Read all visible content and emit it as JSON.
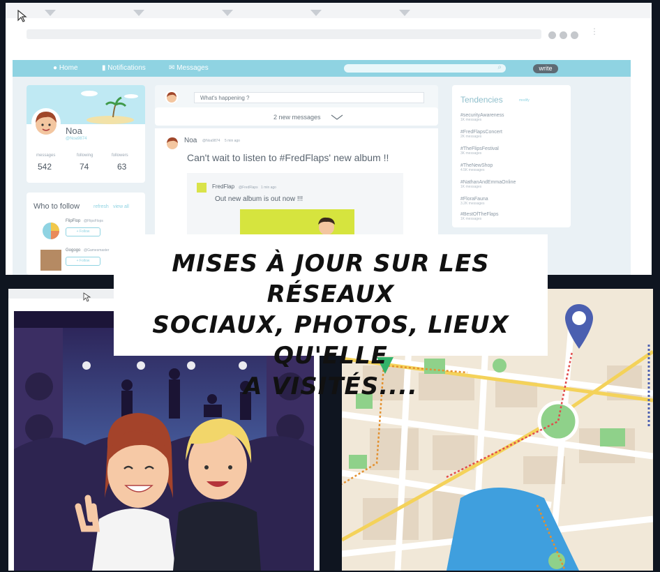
{
  "nav": {
    "home": "Home",
    "notifications": "Notifications",
    "messages": "Messages",
    "write": "write"
  },
  "composer": {
    "placeholder": "What's happening ?",
    "new_messages": "2 new messages"
  },
  "profile": {
    "name": "Noa",
    "handle": "@Noa9874",
    "stats": [
      {
        "label": "messages",
        "value": "542"
      },
      {
        "label": "following",
        "value": "74"
      },
      {
        "label": "followers",
        "value": "63"
      }
    ]
  },
  "who_to_follow": {
    "title": "Who to follow",
    "refresh": "refresh",
    "view_all": "view all",
    "suggestions": [
      {
        "name": "FlipFlop",
        "handle": "@FlipsFlops",
        "button": "+ Follow"
      },
      {
        "name": "Gogogo",
        "handle": "@Gamesmaster",
        "button": "+ Follow"
      }
    ]
  },
  "post": {
    "author": "Noa",
    "handle": "@Noa9874",
    "time": "5 min ago",
    "text": "Can't wait to listen to #FredFlaps' new album !!",
    "quoted": {
      "author": "FredFlap",
      "handle": "@FredFlaps",
      "time": "1 min ago",
      "text": "Out new album is out now !!!"
    }
  },
  "trends": {
    "title": "Tendencies",
    "modify": "modify",
    "items": [
      {
        "tag": "#securityAwareness",
        "count": "1K messages"
      },
      {
        "tag": "#FredFlapsConcert",
        "count": "2K messages"
      },
      {
        "tag": "#TheFlipsFestival",
        "count": "3K messages"
      },
      {
        "tag": "#TheNewShop",
        "count": "4.5K messages"
      },
      {
        "tag": "#NathanAndEmmaOnline",
        "count": "1K messages"
      },
      {
        "tag": "#FloraFauna",
        "count": "3.2K messages"
      },
      {
        "tag": "#BestOfTheFlaps",
        "count": "1K messages"
      }
    ]
  },
  "callout": {
    "line1": "MISES À JOUR SUR LES RÉSEAUX",
    "line2": "SOCIAUX, PHOTOS, LIEUX QU'ELLE",
    "line3": "A VISITÉS...."
  },
  "colors": {
    "navbar": "#8fd3e2",
    "callout_bg": "#ffffff",
    "map_bg": "#f1e8d8",
    "map_park": "#8fd18a",
    "map_water": "#3f9fde",
    "pin_blue": "#4b5fb0",
    "stage_purple": "#3e2c6a"
  }
}
